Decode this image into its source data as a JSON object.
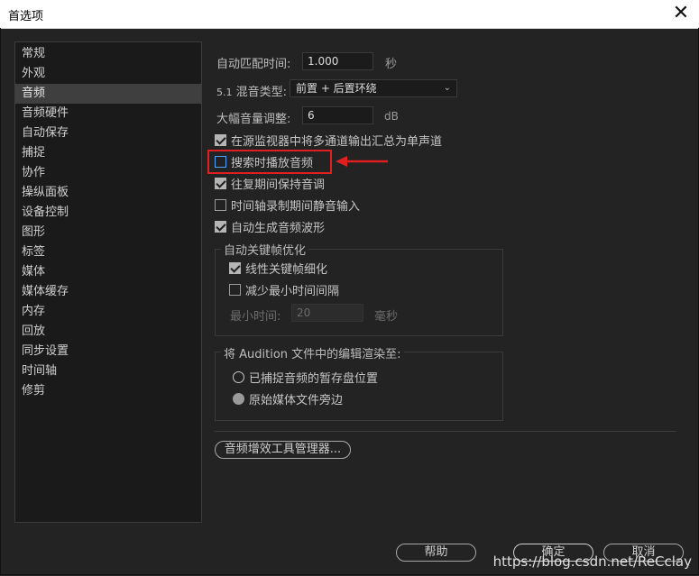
{
  "window": {
    "title": "首选项"
  },
  "sidebar": {
    "items": [
      "常规",
      "外观",
      "音频",
      "音频硬件",
      "自动保存",
      "捕捉",
      "协作",
      "操纵面板",
      "设备控制",
      "图形",
      "标签",
      "媒体",
      "媒体缓存",
      "内存",
      "回放",
      "同步设置",
      "时间轴",
      "修剪"
    ],
    "selected_index": 2
  },
  "settings": {
    "auto_match": {
      "label": "自动匹配时间:",
      "value": "1.000",
      "unit": "秒"
    },
    "mix_type": {
      "prefix": "5.1",
      "label": "混音类型:",
      "value": "前置 + 后置环绕"
    },
    "large_volume": {
      "label": "大幅音量调整:",
      "value": "6",
      "unit": "dB"
    },
    "checkboxes": [
      {
        "label": "在源监视器中将多通道输出汇总为单声道",
        "checked": true
      },
      {
        "label": "搜索时播放音频",
        "checked": false
      },
      {
        "label": "往复期间保持音调",
        "checked": true
      },
      {
        "label": "时间轴录制期间静音输入",
        "checked": false
      },
      {
        "label": "自动生成音频波形",
        "checked": true
      }
    ],
    "keyframe_group": {
      "title": "自动关键帧优化",
      "linear": {
        "label": "线性关键帧细化",
        "checked": true
      },
      "reduce": {
        "label": "减少最小时间间隔",
        "checked": false
      },
      "min_time": {
        "label": "最小时间:",
        "value": "20",
        "unit": "毫秒"
      }
    },
    "render_group": {
      "title": "将 Audition 文件中的编辑渲染至:",
      "options": [
        "已捕捉音频的暂存盘位置",
        "原始媒体文件旁边"
      ],
      "selected_index": 1
    },
    "plugin_manager_label": "音频增效工具管理器..."
  },
  "footer": {
    "help": "帮助",
    "ok": "确定",
    "cancel": "取消"
  },
  "watermark": "https://blog.csdn.net/ReCclay",
  "colors": {
    "highlight": "#e02020",
    "focus": "#4da3ff"
  }
}
